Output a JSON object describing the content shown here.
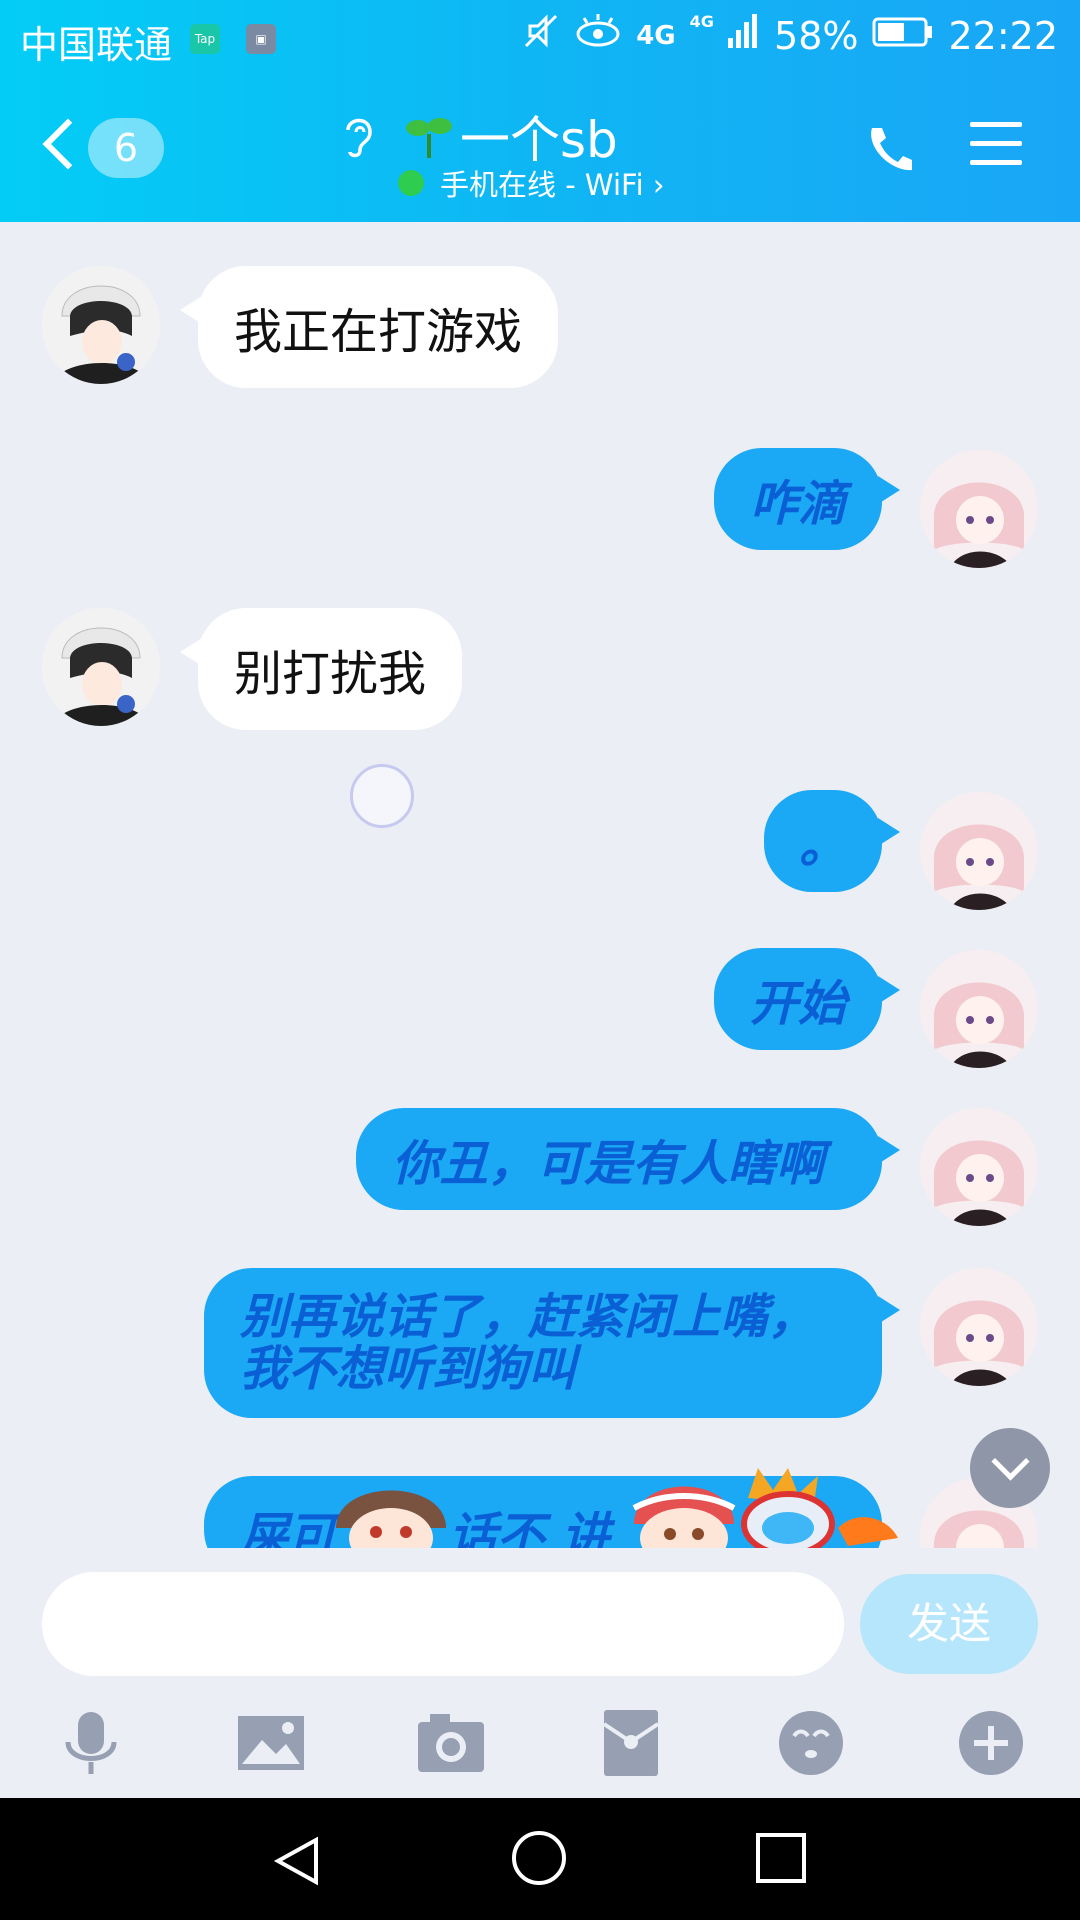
{
  "status_bar": {
    "carrier": "中国联通",
    "badge_tap": "Tap",
    "network": "4G",
    "network2": "4G",
    "battery": "58%",
    "time": "22:22"
  },
  "header": {
    "back_count": "6",
    "contact_name": "一个sb",
    "status_text": "手机在线 - WiFi ›"
  },
  "messages": [
    {
      "side": "in",
      "text": "我正在打游戏"
    },
    {
      "side": "out",
      "text": "咋滴"
    },
    {
      "side": "in",
      "text": "别打扰我"
    },
    {
      "side": "out",
      "text": "。"
    },
    {
      "side": "out",
      "text": "开始"
    },
    {
      "side": "out",
      "text": "你丑，可是有人瞎啊"
    },
    {
      "side": "out",
      "text": "别再说话了，赶紧闭上嘴，我不想听到狗叫"
    },
    {
      "side": "out",
      "text": "屎可 吃，话不 讲"
    }
  ],
  "input": {
    "placeholder": "",
    "send_label": "发送"
  },
  "colors": {
    "header_start": "#03cdf6",
    "header_end": "#1aa6f6",
    "outgoing_bubble": "#1ba8f5",
    "outgoing_text": "#0b5fd4",
    "send_button": "#b6e6fb"
  },
  "toolbar_icons": [
    "microphone-icon",
    "image-icon",
    "camera-icon",
    "red-envelope-icon",
    "emoji-icon",
    "plus-icon"
  ]
}
